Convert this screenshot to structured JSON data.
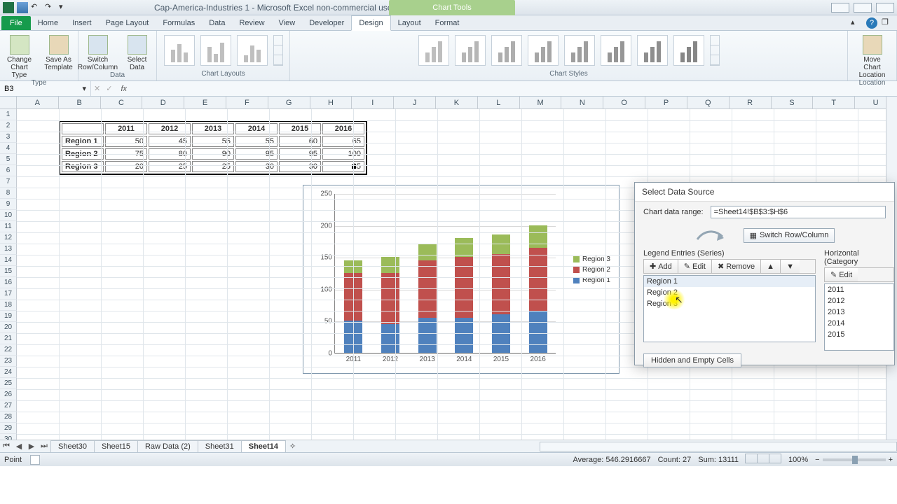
{
  "title": "Cap-America-Industries 1  -  Microsoft Excel non-commercial use",
  "chart_tools_caption": "Chart Tools",
  "tabs": [
    "File",
    "Home",
    "Insert",
    "Page Layout",
    "Formulas",
    "Data",
    "Review",
    "View",
    "Developer",
    "Design",
    "Layout",
    "Format"
  ],
  "active_tab": "Design",
  "ribbon": {
    "type_group": "Type",
    "change_chart_type": "Change Chart Type",
    "save_as_template": "Save As Template",
    "data_group": "Data",
    "switch_rowcol": "Switch Row/Column",
    "select_data": "Select Data",
    "chart_layouts": "Chart Layouts",
    "chart_styles": "Chart Styles",
    "location_group": "Location",
    "move_chart": "Move Chart Location"
  },
  "namebox": "B3",
  "columns": [
    "A",
    "B",
    "C",
    "D",
    "E",
    "F",
    "G",
    "H",
    "I",
    "J",
    "K",
    "L",
    "M",
    "N",
    "O",
    "P",
    "Q",
    "R",
    "S",
    "T",
    "U"
  ],
  "row_count": 30,
  "table": {
    "years": [
      "2011",
      "2012",
      "2013",
      "2014",
      "2015",
      "2016"
    ],
    "rows": [
      {
        "name": "Region 1",
        "vals": [
          50,
          45,
          55,
          55,
          60,
          65
        ]
      },
      {
        "name": "Region 2",
        "vals": [
          75,
          80,
          90,
          95,
          95,
          100
        ]
      },
      {
        "name": "Region 3",
        "vals": [
          20,
          25,
          25,
          30,
          30,
          35
        ]
      }
    ]
  },
  "chart_data": {
    "type": "bar",
    "stacked": true,
    "categories": [
      "2011",
      "2012",
      "2013",
      "2014",
      "2015",
      "2016"
    ],
    "series": [
      {
        "name": "Region 1",
        "values": [
          50,
          45,
          55,
          55,
          60,
          65
        ],
        "color": "#4f81bd"
      },
      {
        "name": "Region 2",
        "values": [
          75,
          80,
          90,
          95,
          95,
          100
        ],
        "color": "#c0504d"
      },
      {
        "name": "Region 3",
        "values": [
          20,
          25,
          25,
          30,
          30,
          35
        ],
        "color": "#9bbb59"
      }
    ],
    "ylim": [
      0,
      250
    ],
    "ystep": 50,
    "legend_order": [
      "Region 3",
      "Region 2",
      "Region 1"
    ]
  },
  "dialog": {
    "title": "Select Data Source",
    "range_label": "Chart data range:",
    "range_value": "=Sheet14!$B$3:$H$6",
    "switch": "Switch Row/Column",
    "legend_label": "Legend Entries (Series)",
    "cat_label": "Horizontal (Category",
    "buttons": {
      "add": "Add",
      "edit": "Edit",
      "remove": "Remove",
      "edit2": "Edit"
    },
    "series": [
      "Region 1",
      "Region 2",
      "Region 3"
    ],
    "selected_series": "Region 1",
    "categories": [
      "2011",
      "2012",
      "2013",
      "2014",
      "2015"
    ],
    "hidden_btn": "Hidden and Empty Cells"
  },
  "sheet_tabs": [
    "Sheet30",
    "Sheet15",
    "Raw Data (2)",
    "Sheet31",
    "Sheet14"
  ],
  "active_sheet": "Sheet14",
  "status": {
    "mode": "Point",
    "average": "Average: 546.2916667",
    "count": "Count: 27",
    "sum": "Sum: 13111",
    "zoom": "100%"
  }
}
